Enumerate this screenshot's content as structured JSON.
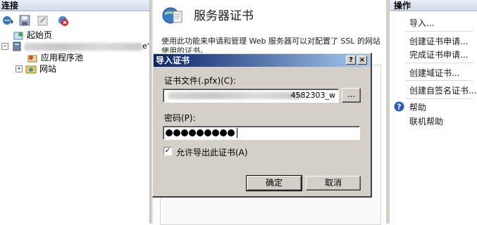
{
  "colors": {
    "titlebar_start": "#0a246a",
    "titlebar_end": "#a6caf0",
    "dialog_face": "#d4d0c8",
    "pane_header": "#dde4ee"
  },
  "connections": {
    "header": "连接",
    "toolbar_icons": [
      "connect-icon",
      "save-icon",
      "back-icon",
      "disconnect-icon"
    ],
    "tree": {
      "start_page": "起始页",
      "server_suffix": "e'",
      "app_pools": "应用程序池",
      "sites": "网站"
    }
  },
  "feature": {
    "title": "服务器证书",
    "description": "使用此功能来申请和管理 Web 服务器可以对配置了 SSL 的网站使用的证书。"
  },
  "actions": {
    "header": "操作",
    "import": "导入...",
    "create_request": "创建证书申请...",
    "complete_request": "完成证书申请...",
    "create_domain": "创建域证书...",
    "create_self_signed": "创建自签名证书...",
    "help": "帮助",
    "online_help": "联机帮助"
  },
  "dialog": {
    "title": "导入证书",
    "help_btn": "?",
    "close_btn": "×",
    "file_label": "证书文件(.pfx)(C):",
    "file_value_visible": "4582303_w",
    "browse_btn": "...",
    "password_label": "密码(P):",
    "password_mask_count": 9,
    "allow_export_label": "允许导出此证书(A)",
    "allow_export_checked": true,
    "ok_btn": "确定",
    "cancel_btn": "取消"
  }
}
